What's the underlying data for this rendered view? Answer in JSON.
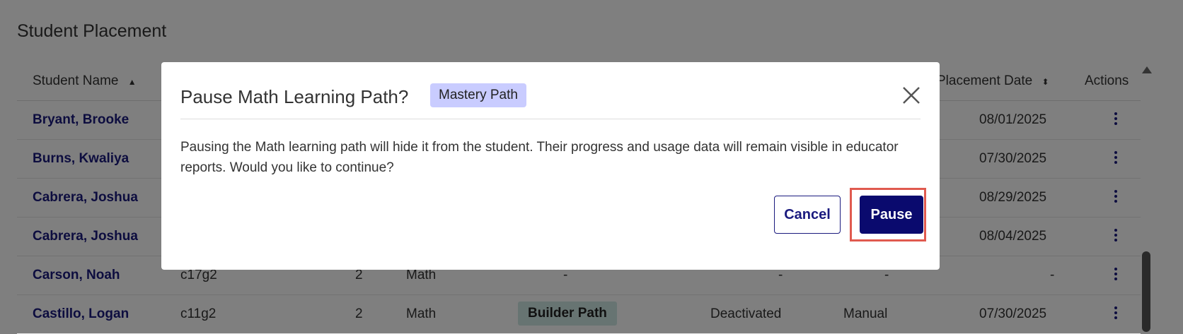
{
  "page": {
    "section_title": "Student Placement",
    "columns": {
      "student_name": "Student Name",
      "placement_date": "Placement Date",
      "actions": "Actions"
    },
    "rows": [
      {
        "name": "Bryant, Brooke",
        "date": "08/01/2025"
      },
      {
        "name": "Burns, Kwaliya",
        "date": "07/30/2025"
      },
      {
        "name": "Cabrera, Joshua",
        "date": "08/29/2025"
      },
      {
        "name": "Cabrera, Joshua",
        "date": "08/04/2025"
      },
      {
        "name": "Carson, Noah",
        "class": "c17g2",
        "grade": "2",
        "subject": "Math",
        "path": "-",
        "status": "-",
        "type": "-",
        "date": "-"
      },
      {
        "name": "Castillo, Logan",
        "class": "c11g2",
        "grade": "2",
        "subject": "Math",
        "path": "Builder Path",
        "status": "Deactivated",
        "type": "Manual",
        "date": "07/30/2025"
      }
    ]
  },
  "modal": {
    "title": "Pause Math Learning Path?",
    "badge": "Mastery Path",
    "message": "Pausing the Math learning path will hide it from the student. Their progress and usage data will remain visible in educator reports. Would you like to continue?",
    "cancel_label": "Cancel",
    "pause_label": "Pause"
  },
  "colors": {
    "primary": "#0a0a6e",
    "badge_bg": "#c9ccff",
    "highlight": "#e05a4f"
  }
}
